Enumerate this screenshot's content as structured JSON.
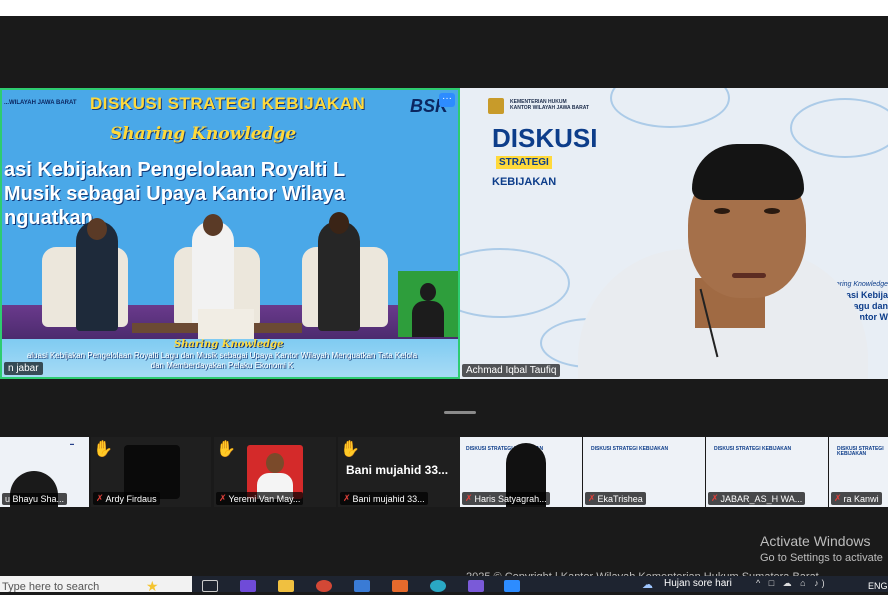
{
  "main_tiles": {
    "left": {
      "name_tag": "n jabar",
      "more_label": "···",
      "headline": "DISKUSI STRATEGI KEBIJAKAN",
      "logo_right": "BSK",
      "logo_left": "...WILAYAH JAWA BARAT",
      "sharing": "Sharing Knowledge",
      "big_line1": "asi Kebijakan Pengelolaan Royalti L",
      "big_line2": "Musik sebagai Upaya Kantor Wilaya",
      "big_line3": "nguatkan",
      "bottom_sharing": "Sharing Knowledge",
      "bottom_line1": "aluasi Kebijakan Pengelolaan Royalti Lagu dan Musik sebagai Upaya Kantor Wilayah Menguatkan Tata Kelola",
      "bottom_line2": "dan Memberdayakan Pelaku Ekonomi K"
    },
    "right": {
      "name_tag": "Achmad Iqbal Taufiq",
      "logo_line1": "KEMENTERIAN HUKUM",
      "logo_line2": "KANTOR WILAYAH JAWA BARAT",
      "diskusi": "DISKUSI",
      "strategi": "STRATEGI",
      "kebijakan": "KEBIJAKAN",
      "side_sharing": "Sharing Knowledge",
      "side_line1": "Evaluasi Kebija",
      "side_line2": "Lagu dan",
      "side_line3": "Kantor W"
    }
  },
  "strip": [
    {
      "name": "u Bhayu Sha...",
      "muted": false,
      "hand": false
    },
    {
      "name": "Ardy Firdaus",
      "muted": true,
      "hand": true
    },
    {
      "name": "Yeremi Van May...",
      "muted": true,
      "hand": true
    },
    {
      "name": "Bani mujahid 33...",
      "muted": true,
      "hand": true,
      "big": "Bani mujahid 33..."
    },
    {
      "name": "Haris Satyagrah...",
      "muted": true,
      "hand": false
    },
    {
      "name": "EkaTrishea",
      "muted": true,
      "hand": false
    },
    {
      "name": "JABAR_AS_H WA...",
      "muted": true,
      "hand": false
    },
    {
      "name": "ra Kanwi",
      "muted": true,
      "hand": false
    }
  ],
  "strip_slide_text": "DISKUSI STRATEGI KEBIJAKAN",
  "activate": {
    "title": "Activate Windows",
    "subtitle": "Go to Settings to activate"
  },
  "copyright": "2025 © Copyright | Kantor Wilayah Kementerian Hukum Sumatera Barat",
  "taskbar": {
    "search_placeholder": "Type here to search",
    "weather": "Hujan sore hari",
    "tray": "^ □ ☁ ⌂ ♪)",
    "lang": "ENG"
  },
  "colors": {
    "active_border": "#2ecc71",
    "zoom_blue": "#2d8cff",
    "mute_red": "#e0403a"
  },
  "icons": [
    "hand-raised-icon",
    "mic-muted-icon",
    "task-view-icon",
    "chrome-icon",
    "file-explorer-icon",
    "zoom-icon"
  ]
}
